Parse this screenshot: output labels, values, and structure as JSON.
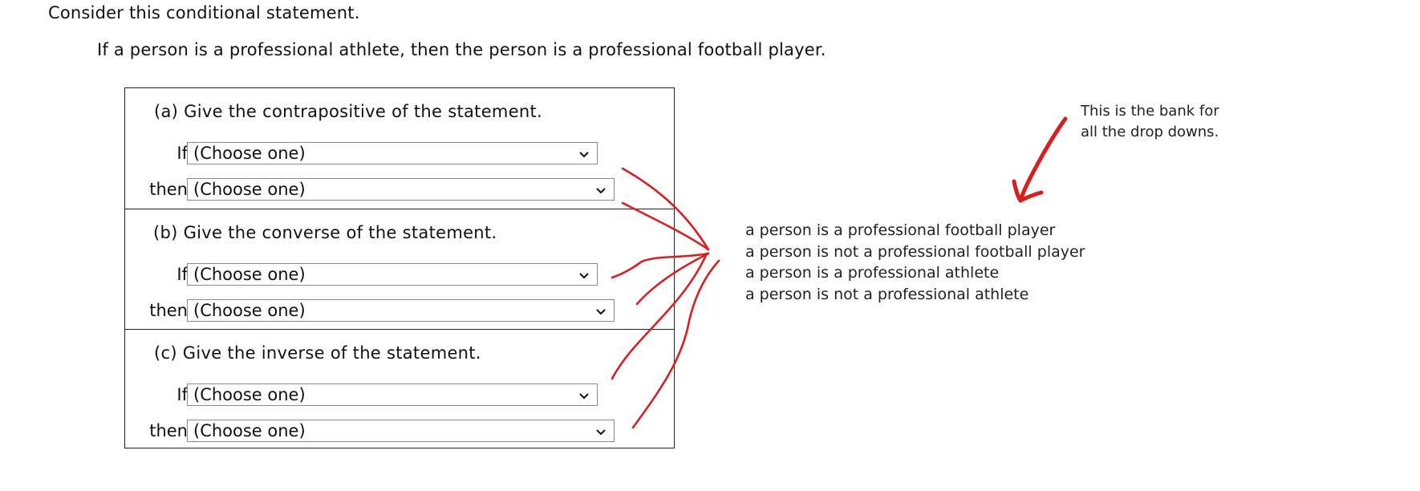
{
  "intro": "Consider this conditional statement.",
  "statement": "If a person is a professional athlete, then the person is a professional football player.",
  "sections": [
    {
      "title": "(a) Give the contrapositive of the statement.",
      "if_label": "If",
      "if_value": "(Choose one)",
      "then_label": "then",
      "then_value": "(Choose one)"
    },
    {
      "title": "(b) Give the converse of the statement.",
      "if_label": "If",
      "if_value": "(Choose one)",
      "then_label": "then",
      "then_value": "(Choose one)"
    },
    {
      "title": "(c) Give the inverse of the statement.",
      "if_label": "If",
      "if_value": "(Choose one)",
      "then_label": "then",
      "then_value": "(Choose one)"
    }
  ],
  "note": {
    "line1": "This is the bank for",
    "line2": "all the drop downs."
  },
  "bank": [
    "a person is a professional football player",
    "a person is not a professional football player",
    "a person is a professional athlete",
    "a person is not a professional athlete"
  ],
  "colors": {
    "ink": "#d81f1f",
    "border": "#222222",
    "dropdown_border": "#8a8a8a"
  },
  "icons": {
    "dropdown": "chevron-down-icon",
    "arrow": "hand-drawn-arrow-icon"
  }
}
